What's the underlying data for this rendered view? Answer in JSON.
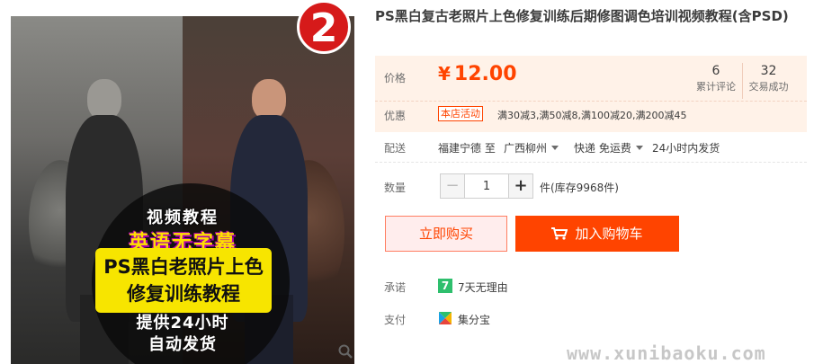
{
  "badge": {
    "number": "2"
  },
  "image": {
    "promo_line1": "视频教程",
    "promo_line2": "英语无字幕",
    "promo_line3": "PS黑白老照片上色",
    "promo_line4": "修复训练教程",
    "promo_line5": "提供24小时",
    "promo_line6": "自动发货"
  },
  "product": {
    "title": "PS黑白复古老照片上色修复训练后期修图调色培训视频教程(含PSD)"
  },
  "price": {
    "label": "价格",
    "currency": "¥",
    "value": "12.00",
    "reviews_count": "6",
    "reviews_label": "累计评论",
    "deals_count": "32",
    "deals_label": "交易成功"
  },
  "promotion": {
    "label": "优惠",
    "tag": "本店活动",
    "text": "满30减3,满50减8,满100减20,满200减45"
  },
  "shipping": {
    "label": "配送",
    "from": "福建宁德 至",
    "to": "广西柳州",
    "method": "快递 免运费",
    "time": "24小时内发货"
  },
  "quantity": {
    "label": "数量",
    "minus": "−",
    "value": "1",
    "plus": "+",
    "stock": "件(库存9968件)"
  },
  "actions": {
    "buy_now": "立即购买",
    "add_to_cart": "加入购物车"
  },
  "promise": {
    "label": "承诺",
    "icon_text": "7",
    "text": "7天无理由"
  },
  "payment": {
    "label": "支付",
    "text": "集分宝"
  },
  "watermark": "www.xunibaoku.com",
  "colors": {
    "accent": "#ff4400",
    "price_panel_bg": "#fff2e8",
    "badge_red": "#d61a1a",
    "promise_green": "#2ebf6d"
  }
}
